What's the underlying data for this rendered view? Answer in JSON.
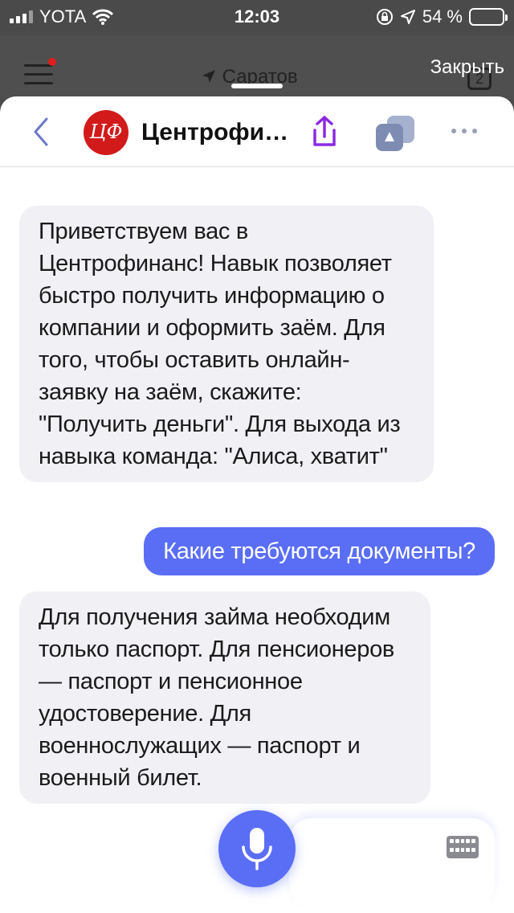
{
  "status_bar": {
    "carrier": "YOTA",
    "time": "12:03",
    "battery_percent": "54 %",
    "battery_level": 0.54
  },
  "browser": {
    "city": "Саратов",
    "close_label": "Закрыть",
    "tabs_count": "2"
  },
  "skill": {
    "title": "Центрофинанс",
    "logo_text": "ЦФ"
  },
  "messages": [
    {
      "from": "bot",
      "text": "Приветствуем вас в Центрофинанс! Навык позволяет быстро получить информацию о компании и оформить заём. Для того, чтобы оставить онлайн-заявку на заём, скажите: \"Получить деньги\". Для выхода из навыка команда: \"Алиса, хватит\""
    },
    {
      "from": "user",
      "text": "Какие требуются документы?"
    },
    {
      "from": "bot",
      "text": "Для получения займа необходим только паспорт. Для пенсионеров — паспорт и пенсионное удостоверение. Для военнослужащих — паспорт и военный билет."
    }
  ],
  "icons": {
    "back": "chevron-left-icon",
    "share": "share-icon",
    "cards": "cards-icon",
    "more": "more-icon",
    "mic": "microphone-icon",
    "keyboard": "keyboard-icon"
  },
  "colors": {
    "accent": "#5a6ef5",
    "share_icon": "#8a2be2",
    "logo": "#d21a1a",
    "bot_bubble": "#f0f0f5"
  }
}
